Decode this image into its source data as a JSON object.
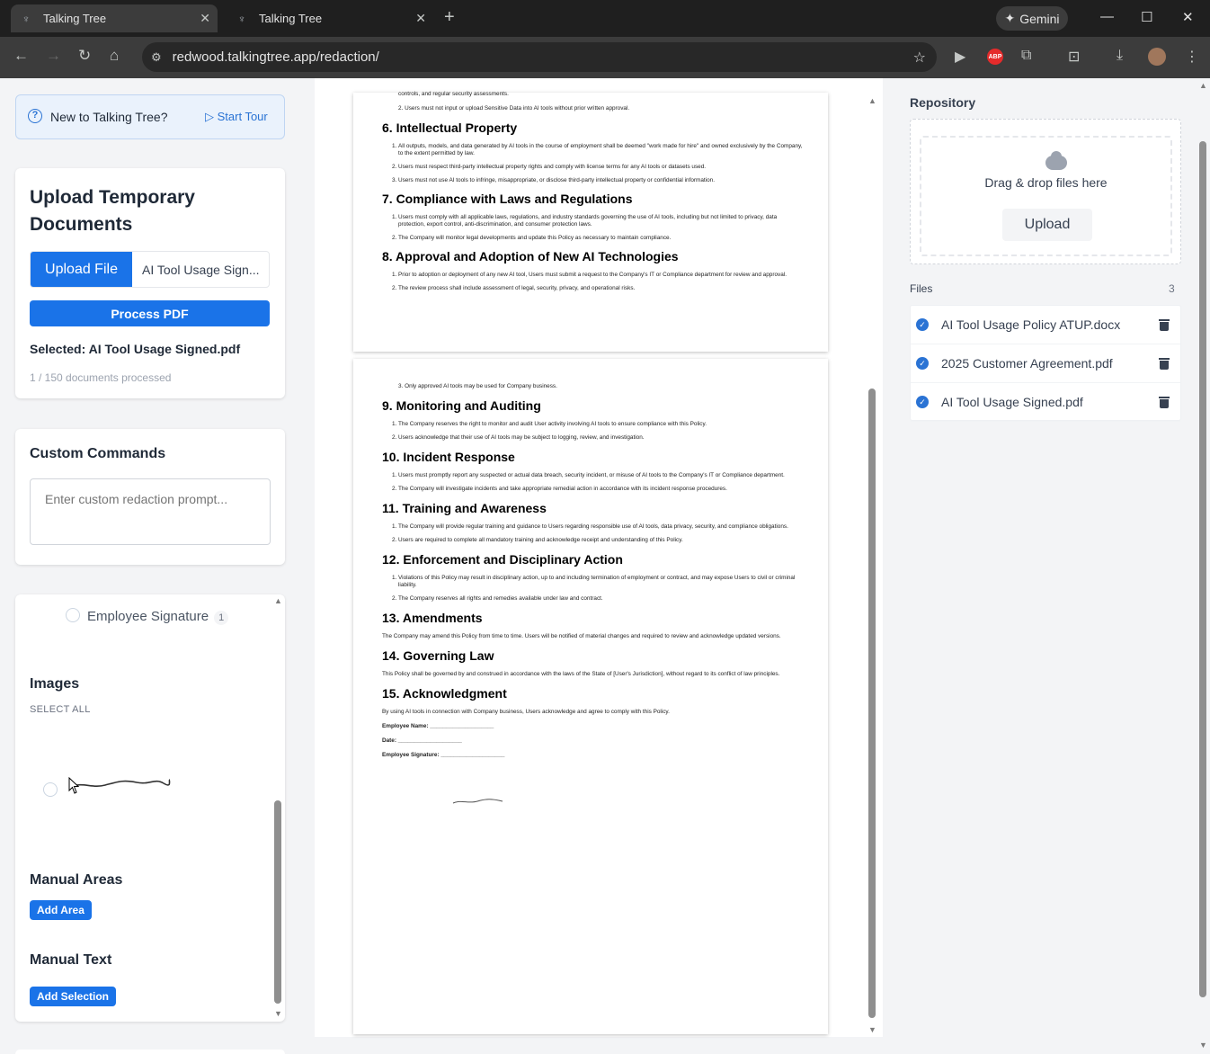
{
  "browser": {
    "tabs": [
      {
        "title": "Talking Tree",
        "active": true
      },
      {
        "title": "Talking Tree",
        "active": false
      }
    ],
    "gemini_label": "Gemini",
    "url": "redwood.talkingtree.app/redaction/",
    "abp_label": "ABP"
  },
  "tour": {
    "text": "New to Talking Tree?",
    "button": "▷ Start Tour"
  },
  "upload": {
    "title": "Upload Temporary Documents",
    "upload_button": "Upload File",
    "file_name": "AI Tool Usage Sign...",
    "process_button": "Process PDF",
    "selected": "Selected: AI Tool Usage Signed.pdf",
    "progress": "1 / 150 documents processed"
  },
  "custom_commands": {
    "title": "Custom Commands",
    "placeholder": "Enter custom redaction prompt..."
  },
  "entities": {
    "employee_signature_label": "Employee Signature",
    "employee_signature_count": "1",
    "images_title": "Images",
    "select_all": "SELECT ALL",
    "manual_areas_title": "Manual Areas",
    "add_area": "Add Area",
    "manual_text_title": "Manual Text",
    "add_selection": "Add Selection"
  },
  "document": {
    "page1_top_lines": [
      "controls, and regular security assessments.",
      "2. Users must not input or upload Sensitive Data into AI tools without prior written approval."
    ],
    "sections_page1": [
      {
        "heading": "6. Intellectual Property",
        "items": [
          "All outputs, models, and data generated by AI tools in the course of employment shall be deemed \"work made for hire\" and owned exclusively by the Company, to the extent permitted by law.",
          "Users must respect third-party intellectual property rights and comply with license terms for any AI tools or datasets used.",
          "Users must not use AI tools to infringe, misappropriate, or disclose third-party intellectual property or confidential information."
        ]
      },
      {
        "heading": "7. Compliance with Laws and Regulations",
        "items": [
          "Users must comply with all applicable laws, regulations, and industry standards governing the use of AI tools, including but not limited to privacy, data protection, export control, anti-discrimination, and consumer protection laws.",
          "The Company will monitor legal developments and update this Policy as necessary to maintain compliance."
        ]
      },
      {
        "heading": "8. Approval and Adoption of New AI Technologies",
        "items": [
          "Prior to adoption or deployment of any new AI tool, Users must submit a request to the Company's IT or Compliance department for review and approval.",
          "The review process shall include assessment of legal, security, privacy, and operational risks."
        ]
      }
    ],
    "page2_top_line": "3. Only approved AI tools may be used for Company business.",
    "sections_page2": [
      {
        "heading": "9. Monitoring and Auditing",
        "items": [
          "The Company reserves the right to monitor and audit User activity involving AI tools to ensure compliance with this Policy.",
          "Users acknowledge that their use of AI tools may be subject to logging, review, and investigation."
        ]
      },
      {
        "heading": "10. Incident Response",
        "items": [
          "Users must promptly report any suspected or actual data breach, security incident, or misuse of AI tools to the Company's IT or Compliance department.",
          "The Company will investigate incidents and take appropriate remedial action in accordance with its incident response procedures."
        ]
      },
      {
        "heading": "11. Training and Awareness",
        "items": [
          "The Company will provide regular training and guidance to Users regarding responsible use of AI tools, data privacy, security, and compliance obligations.",
          "Users are required to complete all mandatory training and acknowledge receipt and understanding of this Policy."
        ]
      },
      {
        "heading": "12. Enforcement and Disciplinary Action",
        "items": [
          "Violations of this Policy may result in disciplinary action, up to and including termination of employment or contract, and may expose Users to civil or criminal liability.",
          "The Company reserves all rights and remedies available under law and contract."
        ]
      },
      {
        "heading": "13. Amendments",
        "para": "The Company may amend this Policy from time to time. Users will be notified of material changes and required to review and acknowledge updated versions."
      },
      {
        "heading": "14. Governing Law",
        "para": "This Policy shall be governed by and construed in accordance with the laws of the State of [User's Jurisdiction], without regard to its conflict of law principles."
      },
      {
        "heading": "15. Acknowledgment",
        "para": "By using AI tools in connection with Company business, Users acknowledge and agree to comply with this Policy."
      }
    ],
    "sign_fields": [
      "Employee Name: ____________________",
      "Date: ____________________",
      "Employee Signature: ____________________"
    ]
  },
  "repository": {
    "title": "Repository",
    "drop_text": "Drag & drop files here",
    "upload_button": "Upload",
    "files_label": "Files",
    "files_count": "3",
    "files": [
      {
        "name": "AI Tool Usage Policy ATUP.docx"
      },
      {
        "name": "2025 Customer Agreement.pdf"
      },
      {
        "name": "AI Tool Usage Signed.pdf"
      }
    ]
  },
  "colors": {
    "primary": "#1a73e8",
    "chrome_dark": "#1f1f1f",
    "toolbar": "#3c3c3c"
  }
}
